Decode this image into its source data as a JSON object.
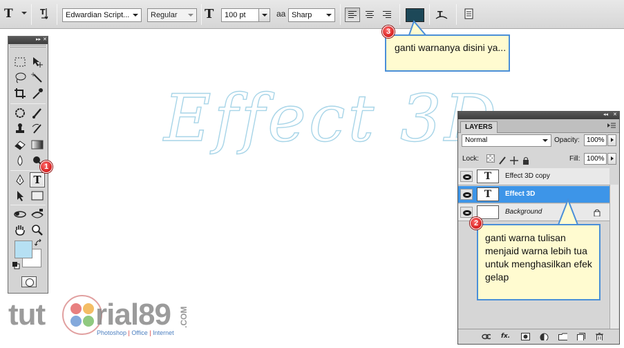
{
  "options_bar": {
    "tool_preset_glyph": "T",
    "font_family": "Edwardian Script...",
    "font_style": "Regular",
    "font_size": "100 pt",
    "aa_label": "aa",
    "antialias": "Sharp",
    "text_color": "#1d4858",
    "icons": [
      "tool-preset-icon",
      "text-orientation-icon",
      "font-size-icon",
      "antialias-icon",
      "align-left-icon",
      "align-center-icon",
      "align-right-icon",
      "warp-text-icon",
      "character-palette-icon"
    ]
  },
  "canvas": {
    "text": "Effect 3D",
    "text_color": "#a8d5e8"
  },
  "tools_panel": {
    "type_tool_glyph": "T",
    "foreground_color": "#b6e0f3",
    "background_color": "#ffffff",
    "icons": [
      "marquee-icon",
      "move-icon",
      "lasso-icon",
      "magic-wand-icon",
      "crop-icon",
      "eyedropper-icon",
      "healing-brush-icon",
      "brush-icon",
      "clone-stamp-icon",
      "history-brush-icon",
      "eraser-icon",
      "gradient-icon",
      "blur-icon",
      "dodge-icon",
      "pen-icon",
      "type-icon",
      "path-selection-icon",
      "rectangle-icon",
      "3d-rotate-icon",
      "3d-orbit-icon",
      "hand-icon",
      "zoom-icon"
    ]
  },
  "layers_panel": {
    "tab_label": "LAYERS",
    "blend_mode": "Normal",
    "opacity_label": "Opacity:",
    "opacity_value": "100%",
    "lock_label": "Lock:",
    "fill_label": "Fill:",
    "fill_value": "100%",
    "layers": [
      {
        "name": "Effect 3D copy",
        "thumb": "T",
        "selected": false
      },
      {
        "name": "Effect 3D",
        "thumb": "T",
        "selected": true
      },
      {
        "name": "Background",
        "thumb": "",
        "selected": false
      }
    ],
    "footer_fx": "fx."
  },
  "callouts": [
    {
      "number": "1"
    },
    {
      "number": "2",
      "text": "ganti warna tulisan menjaid warna lebih tua untuk menghasilkan efek gelap"
    },
    {
      "number": "3",
      "text": "ganti warnanya disini ya..."
    }
  ],
  "watermark": {
    "part1": "tut",
    "part2": "rial89",
    "suffix": ".COM",
    "tag1": "Photoshop",
    "sep": " | ",
    "tag2": "Office",
    "tag3": "Internet"
  }
}
